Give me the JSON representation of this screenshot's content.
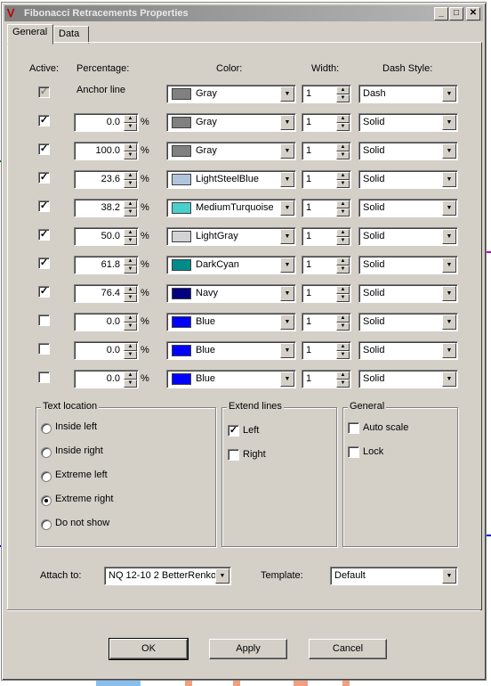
{
  "window": {
    "title": "Fibonacci Retracements Properties"
  },
  "title_buttons": {
    "minimize": "_",
    "maximize": "□",
    "close": "✕"
  },
  "tabs": [
    {
      "label": "General"
    },
    {
      "label": "Data"
    }
  ],
  "headers": {
    "active": "Active:",
    "percentage": "Percentage:",
    "color": "Color:",
    "width": "Width:",
    "dash_style": "Dash Style:"
  },
  "anchor": {
    "label": "Anchor line",
    "color": "Gray",
    "swatch": "#808080",
    "width": "1",
    "dash": "Dash"
  },
  "levels": [
    {
      "active": true,
      "pct": "0.0",
      "color": "Gray",
      "swatch": "#808080",
      "width": "1",
      "dash": "Solid"
    },
    {
      "active": true,
      "pct": "100.0",
      "color": "Gray",
      "swatch": "#808080",
      "width": "1",
      "dash": "Solid"
    },
    {
      "active": true,
      "pct": "23.6",
      "color": "LightSteelBlue",
      "swatch": "#b0c4de",
      "width": "1",
      "dash": "Solid"
    },
    {
      "active": true,
      "pct": "38.2",
      "color": "MediumTurquoise",
      "swatch": "#48d1cc",
      "width": "1",
      "dash": "Solid"
    },
    {
      "active": true,
      "pct": "50.0",
      "color": "LightGray",
      "swatch": "#d3d3d3",
      "width": "1",
      "dash": "Solid"
    },
    {
      "active": true,
      "pct": "61.8",
      "color": "DarkCyan",
      "swatch": "#008b8b",
      "width": "1",
      "dash": "Solid"
    },
    {
      "active": true,
      "pct": "76.4",
      "color": "Navy",
      "swatch": "#000080",
      "width": "1",
      "dash": "Solid"
    },
    {
      "active": false,
      "pct": "0.0",
      "color": "Blue",
      "swatch": "#0000ff",
      "width": "1",
      "dash": "Solid"
    },
    {
      "active": false,
      "pct": "0.0",
      "color": "Blue",
      "swatch": "#0000ff",
      "width": "1",
      "dash": "Solid"
    },
    {
      "active": false,
      "pct": "0.0",
      "color": "Blue",
      "swatch": "#0000ff",
      "width": "1",
      "dash": "Solid"
    }
  ],
  "pct_sign": "%",
  "text_location": {
    "title": "Text location",
    "options": [
      "Inside left",
      "Inside right",
      "Extreme left",
      "Extreme right",
      "Do not show"
    ],
    "selected": "Extreme right"
  },
  "extend_lines": {
    "title": "Extend lines",
    "left": "Left",
    "left_checked": true,
    "right": "Right",
    "right_checked": false
  },
  "general": {
    "title": "General",
    "auto_scale": "Auto scale",
    "lock": "Lock"
  },
  "attach": {
    "label": "Attach to:",
    "value": "NQ 12-10 2 BetterRenko"
  },
  "template": {
    "label": "Template:",
    "value": "Default"
  },
  "buttons": {
    "ok": "OK",
    "apply": "Apply",
    "cancel": "Cancel"
  },
  "check_glyph": "✓"
}
